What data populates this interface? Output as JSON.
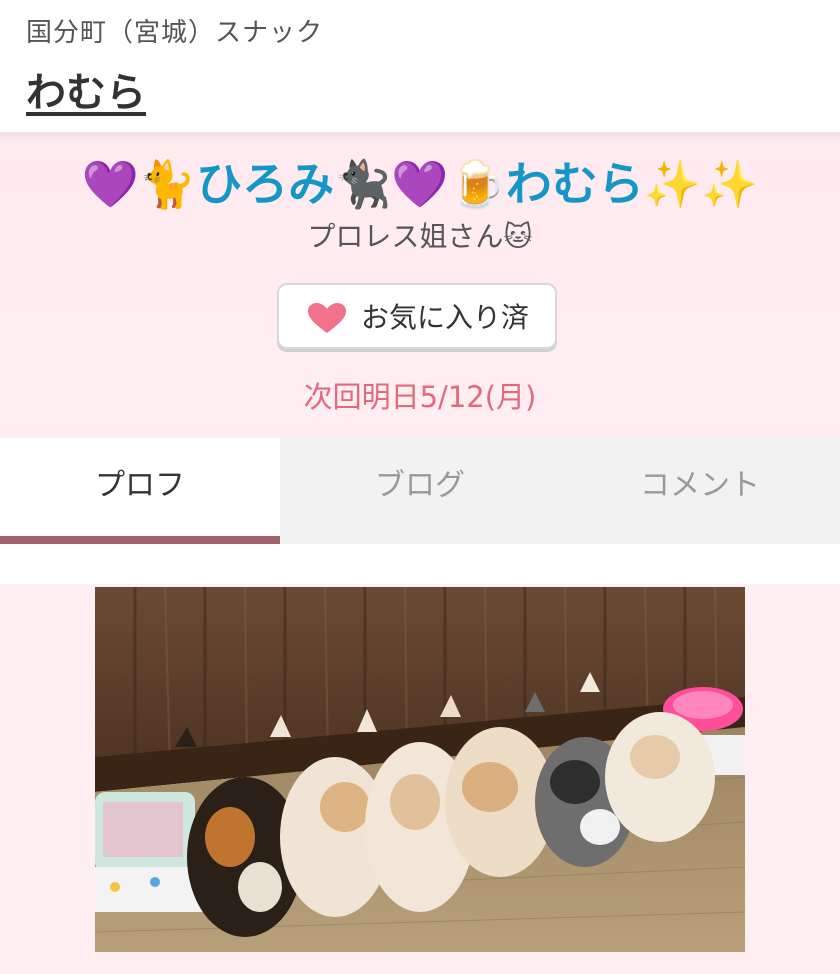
{
  "header": {
    "breadcrumb": "国分町（宮城）スナック",
    "shop_name": "わむら"
  },
  "profile": {
    "name_prefix_emoji": "💜🐈",
    "name_text": "ひろみ",
    "name_middle_emoji": "🐈‍⬛💜🍺",
    "name_shop_text": "わむら",
    "name_suffix_emoji": "✨✨",
    "catch_copy": "プロレス姐さん🐱",
    "favorite_button_label": "お気に入り済",
    "next_work": "次回明日5/12(月)"
  },
  "tabs": [
    {
      "label": "プロフ",
      "active": true
    },
    {
      "label": "ブログ",
      "active": false
    },
    {
      "label": "コメント",
      "active": false
    }
  ],
  "colors": {
    "name_blue": "#1596c8",
    "accent_pink": "#e26a7c",
    "heart": "#f2718b",
    "hero_bg": "#ffeef2",
    "tab_active_underline": "#a0626c"
  },
  "photo": {
    "subject": "six kittens eating side by side"
  }
}
